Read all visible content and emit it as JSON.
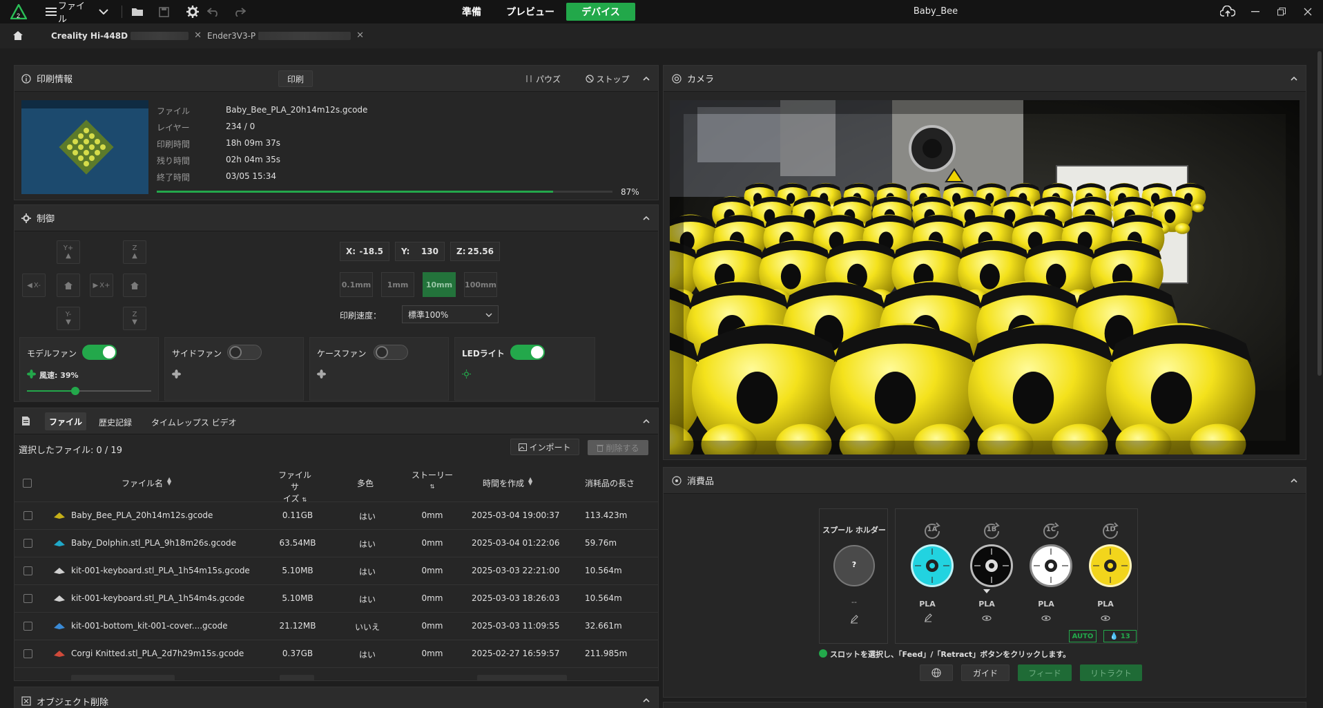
{
  "app": {
    "menu_label": "ファイル",
    "window_title": "Baby_Bee",
    "main_tabs": [
      {
        "label": "準備",
        "active": false
      },
      {
        "label": "プレビュー",
        "active": false
      },
      {
        "label": "デバイス",
        "active": true
      }
    ]
  },
  "device_tabs": [
    {
      "label": "Creality Hi-448D"
    },
    {
      "label": "Ender3V3-P"
    }
  ],
  "print_info": {
    "title": "印刷情報",
    "print_button": "印刷",
    "pause_button": "パウズ",
    "stop_button": "ストップ",
    "fields": [
      {
        "label": "ファイル",
        "value": "Baby_Bee_PLA_20h14m12s.gcode"
      },
      {
        "label": "レイヤー",
        "value": "234 / 0"
      },
      {
        "label": "印刷時間",
        "value": "18h 09m 37s"
      },
      {
        "label": "残り時間",
        "value": "02h 04m 35s"
      },
      {
        "label": "終了時間",
        "value": "03/05 15:34"
      }
    ],
    "progress": 0.87,
    "progress_label": "87%"
  },
  "control": {
    "title": "制御",
    "jog": {
      "y_plus": "Y+",
      "y_minus": "Y-",
      "x_plus": "X+",
      "x_minus": "X-",
      "z_up": "Z",
      "z_down": "Z"
    },
    "coords": [
      {
        "axis": "X:",
        "value": "-18.5"
      },
      {
        "axis": "Y:",
        "value": "130"
      },
      {
        "axis": "Z:",
        "value": "25.56"
      }
    ],
    "steps": [
      {
        "label": "0.1mm",
        "selected": false
      },
      {
        "label": "1mm",
        "selected": false
      },
      {
        "label": "10mm",
        "selected": true
      },
      {
        "label": "100mm",
        "selected": false
      }
    ],
    "speed_label": "印刷速度：",
    "speed_value": "標準100%",
    "fans": [
      {
        "label": "モデルファン",
        "on": true,
        "speed_text": "風速: 39%",
        "speed": 0.39
      },
      {
        "label": "サイドファン",
        "on": false
      },
      {
        "label": "ケースファン",
        "on": false
      },
      {
        "label": "LEDライト",
        "on": true
      }
    ]
  },
  "files": {
    "tabs": [
      {
        "label": "ファイル",
        "active": true
      },
      {
        "label": "歴史記録",
        "active": false
      },
      {
        "label": "タイムレップス ビデオ",
        "active": false
      }
    ],
    "selected_text": "選択したファイル: 0 / 19",
    "import_button": "インポート",
    "delete_button": "削除する",
    "headers": {
      "name": "ファイル名",
      "size_1": "ファイルサ",
      "size_2": "イズ",
      "multicolor": "多色",
      "story_1": "ストーリー",
      "created": "時間を作成",
      "length": "消耗品の長さ"
    },
    "rows": [
      {
        "name": "Baby_Bee_PLA_20h14m12s.gcode",
        "size": "0.11GB",
        "multi": "はい",
        "story": "0mm",
        "created": "2025-03-04 19:00:37",
        "length": "113.423m"
      },
      {
        "name": "Baby_Dolphin.stl_PLA_9h18m26s.gcode",
        "size": "63.54MB",
        "multi": "はい",
        "story": "0mm",
        "created": "2025-03-04 01:22:06",
        "length": "59.76m"
      },
      {
        "name": "kit-001-keyboard.stl_PLA_1h54m15s.gcode",
        "size": "5.10MB",
        "multi": "はい",
        "story": "0mm",
        "created": "2025-03-03 22:21:00",
        "length": "10.564m"
      },
      {
        "name": "kit-001-keyboard.stl_PLA_1h54m4s.gcode",
        "size": "5.10MB",
        "multi": "はい",
        "story": "0mm",
        "created": "2025-03-03 18:26:03",
        "length": "10.564m"
      },
      {
        "name": "kit-001-bottom_kit-001-cover....gcode",
        "size": "21.12MB",
        "multi": "いいえ",
        "story": "0mm",
        "created": "2025-03-03 11:09:55",
        "length": "32.661m"
      },
      {
        "name": "Corgi Knitted.stl_PLA_2d7h29m15s.gcode",
        "size": "0.37GB",
        "multi": "はい",
        "story": "0mm",
        "created": "2025-02-27 16:59:57",
        "length": "211.985m"
      }
    ]
  },
  "object_delete": {
    "title": "オブジェクト削除"
  },
  "camera": {
    "title": "カメラ"
  },
  "consumables": {
    "title": "消費品",
    "spool_holder": "スプール ホルダー",
    "spool_unknown": "?",
    "spool_dash": "--",
    "slots": [
      {
        "id": "1A",
        "type": "PLA",
        "color": "#22d3e0"
      },
      {
        "id": "1B",
        "type": "PLA",
        "color": "#0a0a0a"
      },
      {
        "id": "1C",
        "type": "PLA",
        "color": "#ffffff"
      },
      {
        "id": "1D",
        "type": "PLA",
        "color": "#f2d51c"
      }
    ],
    "auto_badge": "AUTO",
    "humidity": "13",
    "hint": "スロットを選択し、「Feed」/「Retract」ボタンをクリックします。",
    "guide_button": "ガイド",
    "feed_button": "フィード",
    "retract_button": "リトラクト"
  }
}
